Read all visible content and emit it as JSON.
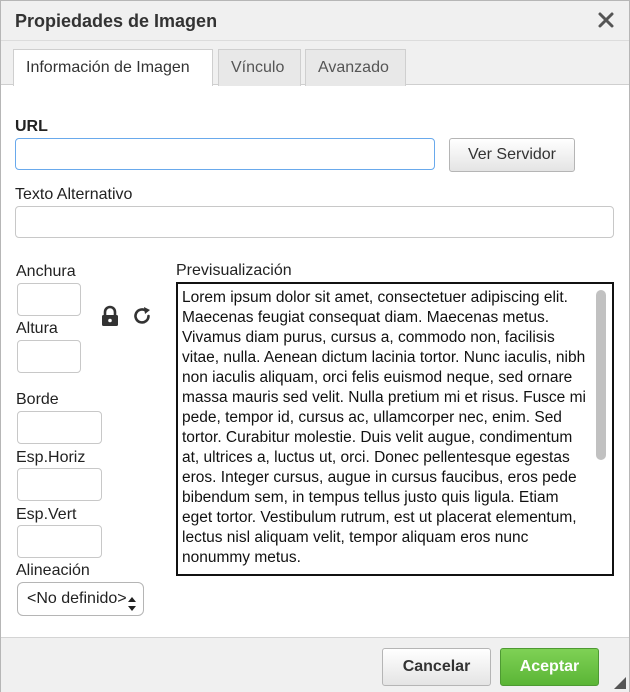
{
  "dialog": {
    "title": "Propiedades de Imagen",
    "close_icon": "close-icon"
  },
  "tabs": [
    {
      "label": "Información de Imagen",
      "active": true
    },
    {
      "label": "Vínculo",
      "active": false
    },
    {
      "label": "Avanzado",
      "active": false
    }
  ],
  "form": {
    "url_label": "URL",
    "url_value": "",
    "browse_label": "Ver Servidor",
    "alt_label": "Texto Alternativo",
    "alt_value": "",
    "width_label": "Anchura",
    "height_label": "Altura",
    "lock_icon": "lock-icon",
    "reset_icon": "reset-size-icon",
    "border_label": "Borde",
    "hspace_label": "Esp.Horiz",
    "vspace_label": "Esp.Vert",
    "align_label": "Alineación",
    "align_value": "<No definido>"
  },
  "preview": {
    "label": "Previsualización",
    "text": "Lorem ipsum dolor sit amet, consectetuer adipiscing elit. Maecenas feugiat consequat diam. Maecenas metus. Vivamus diam purus, cursus a, commodo non, facilisis vitae, nulla. Aenean dictum lacinia tortor. Nunc iaculis, nibh non iaculis aliquam, orci felis euismod neque, sed ornare massa mauris sed velit. Nulla pretium mi et risus. Fusce mi pede, tempor id, cursus ac, ullamcorper nec, enim. Sed tortor. Curabitur molestie. Duis velit augue, condimentum at, ultrices a, luctus ut, orci. Donec pellentesque egestas eros. Integer cursus, augue in cursus faucibus, eros pede bibendum sem, in tempus tellus justo quis ligula. Etiam eget tortor. Vestibulum rutrum, est ut placerat elementum, lectus nisl aliquam velit, tempor aliquam eros nunc nonummy metus."
  },
  "footer": {
    "cancel_label": "Cancelar",
    "accept_label": "Aceptar",
    "accept_color": "#5bb536"
  }
}
